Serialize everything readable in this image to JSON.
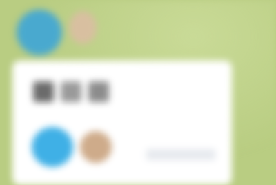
{
  "header": {
    "avatars": [
      {
        "icon": "avatar-blue",
        "color": "#49a9cf"
      },
      {
        "icon": "avatar-tan",
        "color": "#d8bfa0"
      }
    ]
  },
  "dialog": {
    "title_chips": [
      "",
      "",
      ""
    ],
    "options": [
      {
        "icon": "avatar-blue",
        "color": "#3fb0e6"
      },
      {
        "icon": "avatar-tan",
        "color": "#ceab8a"
      }
    ],
    "action_label": ""
  },
  "colors": {
    "background": "#b9cd82",
    "dialog": "#ffffff"
  }
}
